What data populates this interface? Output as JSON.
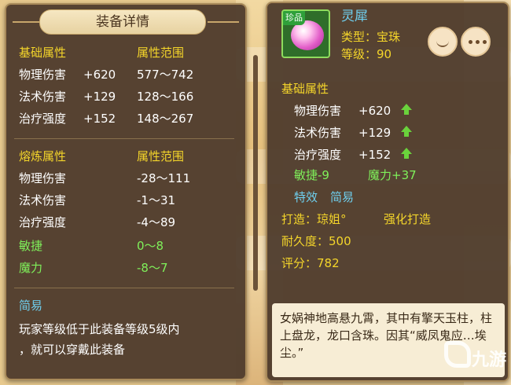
{
  "left": {
    "header": "装备详情",
    "base": {
      "title": "基础属性",
      "range_title": "属性范围",
      "rows": [
        {
          "name": "物理伤害",
          "value": "+620",
          "range": "577～742"
        },
        {
          "name": "法术伤害",
          "value": "+129",
          "range": "128～166"
        },
        {
          "name": "治疗强度",
          "value": "+152",
          "range": "148～267"
        }
      ]
    },
    "refine": {
      "title": "熔炼属性",
      "range_title": "属性范围",
      "rows": [
        {
          "name": "物理伤害",
          "range": "-28～111"
        },
        {
          "name": "法术伤害",
          "range": "-1～31"
        },
        {
          "name": "治疗强度",
          "range": "-4～89"
        },
        {
          "name": "敏捷",
          "range": "0～8"
        },
        {
          "name": "魔力",
          "range": "-8～7"
        }
      ]
    },
    "easy": {
      "title": "简易",
      "lines": [
        "玩家等级低于此装备等级5级内",
        "，就可以穿戴此装备"
      ]
    }
  },
  "right": {
    "item_tag": "珍品",
    "item_name": "灵犀",
    "type": "类型：宝珠",
    "level": "等级：90",
    "base_title": "基础属性",
    "base_rows": [
      {
        "name": "物理伤害",
        "value": "+620"
      },
      {
        "name": "法术伤害",
        "value": "+129"
      },
      {
        "name": "治疗强度",
        "value": "+152"
      }
    ],
    "agility": "敏捷-9",
    "magic": "魔力+37",
    "effect_label": "特效",
    "effect_value": "简易",
    "forge": "打造：琼姐°",
    "enhance": "强化打造",
    "durability": "耐久度：500",
    "score": "评分：782",
    "description": "女娲神地高悬九霄，其中有擎天玉柱，柱上盘龙，龙口含珠。因其“威凤鬼应…埃尘。”"
  },
  "watermark": "九游",
  "colors": {
    "attr_title": "#f4d52a",
    "green": "#7ff05a",
    "cyan": "#6fd0f0",
    "panel": "#4a382a"
  }
}
